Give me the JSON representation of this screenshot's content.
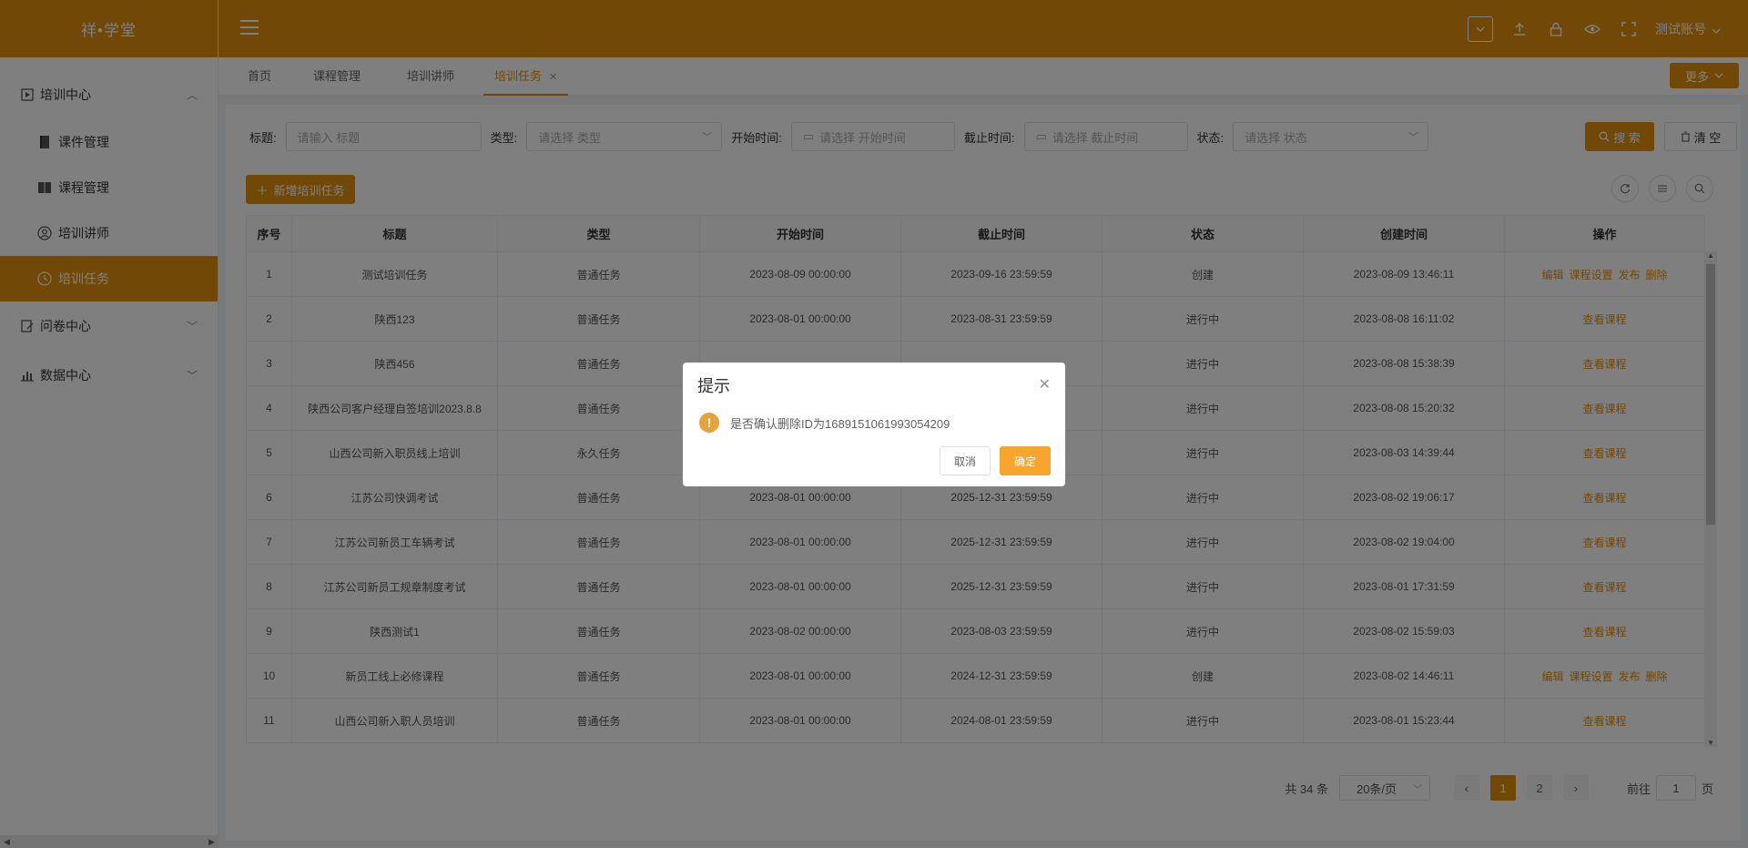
{
  "app": {
    "brand": "祥•学堂"
  },
  "colors": {
    "accent": "#e5900d",
    "warning": "#e6a23c"
  },
  "header": {
    "user_name": "测试账号",
    "icons": [
      "dropdown-icon",
      "upload-icon",
      "lock-icon",
      "eye-icon",
      "fullscreen-icon"
    ]
  },
  "sidebar": {
    "groups": [
      {
        "label": "培训中心",
        "icon": "play-square-icon",
        "expanded": true
      },
      {
        "label": "问卷中心",
        "icon": "edit-doc-icon",
        "expanded": false
      },
      {
        "label": "数据中心",
        "icon": "bar-chart-icon",
        "expanded": false
      }
    ],
    "items": [
      {
        "label": "课件管理",
        "icon": "book-icon"
      },
      {
        "label": "课程管理",
        "icon": "book-open-icon"
      },
      {
        "label": "培训讲师",
        "icon": "user-circle-icon"
      },
      {
        "label": "培训任务",
        "icon": "clock-icon",
        "active": true
      }
    ]
  },
  "tabs": {
    "items": [
      "首页",
      "课程管理",
      "培训讲师",
      "培训任务"
    ],
    "active": "培训任务",
    "more_label": "更多"
  },
  "filters": {
    "title_label": "标题:",
    "title_placeholder": "请输入 标题",
    "type_label": "类型:",
    "type_placeholder": "请选择 类型",
    "start_label": "开始时间:",
    "start_placeholder": "请选择 开始时间",
    "end_label": "截止时间:",
    "end_placeholder": "请选择 截止时间",
    "status_label": "状态:",
    "status_placeholder": "请选择 状态",
    "search_label": "搜 索",
    "clear_label": "清 空"
  },
  "toolbar": {
    "add_label": "新增培训任务"
  },
  "table": {
    "columns": [
      "序号",
      "标题",
      "类型",
      "开始时间",
      "截止时间",
      "状态",
      "创建时间",
      "操作"
    ],
    "rows": [
      {
        "no": "1",
        "title": "测试培训任务",
        "type": "普通任务",
        "start": "2023-08-09 00:00:00",
        "end": "2023-09-16 23:59:59",
        "status": "创建",
        "created": "2023-08-09 13:46:11",
        "ops": [
          "编辑",
          "课程设置",
          "发布",
          "删除"
        ]
      },
      {
        "no": "2",
        "title": "陕西123",
        "type": "普通任务",
        "start": "2023-08-01 00:00:00",
        "end": "2023-08-31 23:59:59",
        "status": "进行中",
        "created": "2023-08-08 16:11:02",
        "ops": [
          "查看课程"
        ]
      },
      {
        "no": "3",
        "title": "陕西456",
        "type": "普通任务",
        "start": "",
        "end": "",
        "status": "进行中",
        "created": "2023-08-08 15:38:39",
        "ops": [
          "查看课程"
        ]
      },
      {
        "no": "4",
        "title": "陕西公司客户经理自签培训2023.8.8",
        "type": "普通任务",
        "start": "",
        "end": "",
        "status": "进行中",
        "created": "2023-08-08 15:20:32",
        "ops": [
          "查看课程"
        ]
      },
      {
        "no": "5",
        "title": "山西公司新入职员线上培训",
        "type": "永久任务",
        "start": "",
        "end": "",
        "status": "进行中",
        "created": "2023-08-03 14:39:44",
        "ops": [
          "查看课程"
        ]
      },
      {
        "no": "6",
        "title": "江苏公司快调考试",
        "type": "普通任务",
        "start": "2023-08-01 00:00:00",
        "end": "2025-12-31 23:59:59",
        "status": "进行中",
        "created": "2023-08-02 19:06:17",
        "ops": [
          "查看课程"
        ]
      },
      {
        "no": "7",
        "title": "江苏公司新员工车辆考试",
        "type": "普通任务",
        "start": "2023-08-01 00:00:00",
        "end": "2025-12-31 23:59:59",
        "status": "进行中",
        "created": "2023-08-02 19:04:00",
        "ops": [
          "查看课程"
        ]
      },
      {
        "no": "8",
        "title": "江苏公司新员工规章制度考试",
        "type": "普通任务",
        "start": "2023-08-01 00:00:00",
        "end": "2025-12-31 23:59:59",
        "status": "进行中",
        "created": "2023-08-01 17:31:59",
        "ops": [
          "查看课程"
        ]
      },
      {
        "no": "9",
        "title": "陕西测试1",
        "type": "普通任务",
        "start": "2023-08-02 00:00:00",
        "end": "2023-08-03 23:59:59",
        "status": "进行中",
        "created": "2023-08-02 15:59:03",
        "ops": [
          "查看课程"
        ]
      },
      {
        "no": "10",
        "title": "新员工线上必修课程",
        "type": "普通任务",
        "start": "2023-08-01 00:00:00",
        "end": "2024-12-31 23:59:59",
        "status": "创建",
        "created": "2023-08-02 14:46:11",
        "ops": [
          "编辑",
          "课程设置",
          "发布",
          "删除"
        ]
      },
      {
        "no": "11",
        "title": "山西公司新入职人员培训",
        "type": "普通任务",
        "start": "2023-08-01 00:00:00",
        "end": "2024-08-01 23:59:59",
        "status": "进行中",
        "created": "2023-08-01 15:23:44",
        "ops": [
          "查看课程"
        ]
      }
    ]
  },
  "pagination": {
    "total_text": "共 34 条",
    "page_size": "20条/页",
    "pages": [
      "1",
      "2"
    ],
    "current": "1",
    "goto_prefix": "前往",
    "goto_value": "1",
    "goto_suffix": "页"
  },
  "dialog": {
    "title": "提示",
    "message": "是否确认删除ID为1689151061993054209",
    "cancel_label": "取消",
    "confirm_label": "确定"
  }
}
